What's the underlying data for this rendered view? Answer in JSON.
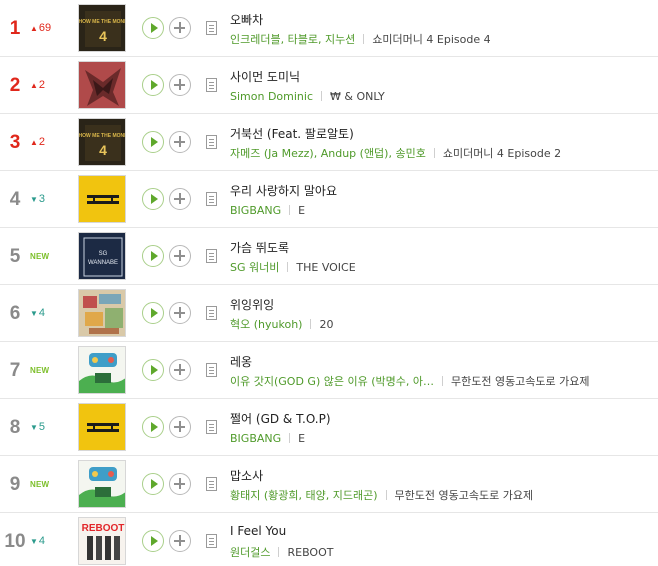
{
  "chart": {
    "rows": [
      {
        "rank": "1",
        "change": "69",
        "dir": "up",
        "title": "오빠차",
        "artist": "인크레더블, 타블로, 지누션",
        "album": "쇼미더머니 4 Episode 4",
        "cover": "smtm"
      },
      {
        "rank": "2",
        "change": "2",
        "dir": "up",
        "title": "사이먼 도미닉",
        "artist": "Simon Dominic",
        "album": "₩ & ONLY",
        "cover": "simon"
      },
      {
        "rank": "3",
        "change": "2",
        "dir": "up",
        "title": "거북선 (Feat. 팔로알토)",
        "artist": "자메즈 (Ja Mezz), Andup (앤덥), 송민호",
        "album": "쇼미더머니 4 Episode 2",
        "cover": "smtm"
      },
      {
        "rank": "4",
        "change": "3",
        "dir": "down",
        "title": "우리 사랑하지 말아요",
        "artist": "BIGBANG",
        "album": "E",
        "cover": "bigbang"
      },
      {
        "rank": "5",
        "change": "NEW",
        "dir": "new",
        "title": "가슴 뛰도록",
        "artist": "SG 워너비",
        "album": "THE VOICE",
        "cover": "sg"
      },
      {
        "rank": "6",
        "change": "4",
        "dir": "down",
        "title": "위잉위잉",
        "artist": "혁오 (hyukoh)",
        "album": "20",
        "cover": "hyukoh"
      },
      {
        "rank": "7",
        "change": "NEW",
        "dir": "new",
        "title": "레옹",
        "artist": "이유 갓지(GOD G) 않은 이유 (박명수, 아…",
        "album": "무한도전 영동고속도로 가요제",
        "cover": "muhan"
      },
      {
        "rank": "8",
        "change": "5",
        "dir": "down",
        "title": "쩔어 (GD & T.O.P)",
        "artist": "BIGBANG",
        "album": "E",
        "cover": "bigbang"
      },
      {
        "rank": "9",
        "change": "NEW",
        "dir": "new",
        "title": "맙소사",
        "artist": "황태지 (황광희, 태양, 지드래곤)",
        "album": "무한도전 영동고속도로 가요제",
        "cover": "muhan"
      },
      {
        "rank": "10",
        "change": "4",
        "dir": "down",
        "title": "I Feel You",
        "artist": "원더걸스",
        "album": "REBOOT",
        "cover": "reboot"
      }
    ]
  },
  "covers": {
    "smtm_text": "SHOW ME THE MONEY",
    "smtm_num": "4",
    "sg_line1": "SG",
    "sg_line2": "WANNABE",
    "reboot_text": "REBOOT"
  },
  "colors": {
    "rank_top": "#e0271b",
    "rank_other": "#8a8a8a",
    "change_up": "#e0271b",
    "change_down": "#2a9a8c",
    "new_badge": "#7cbf2a",
    "artist": "#4f9a2a",
    "play_accent": "#5fa82c"
  },
  "icons": {
    "up": "▲",
    "down": "▼",
    "play": "play-icon",
    "add": "add-icon",
    "lyrics": "lyrics-icon"
  }
}
